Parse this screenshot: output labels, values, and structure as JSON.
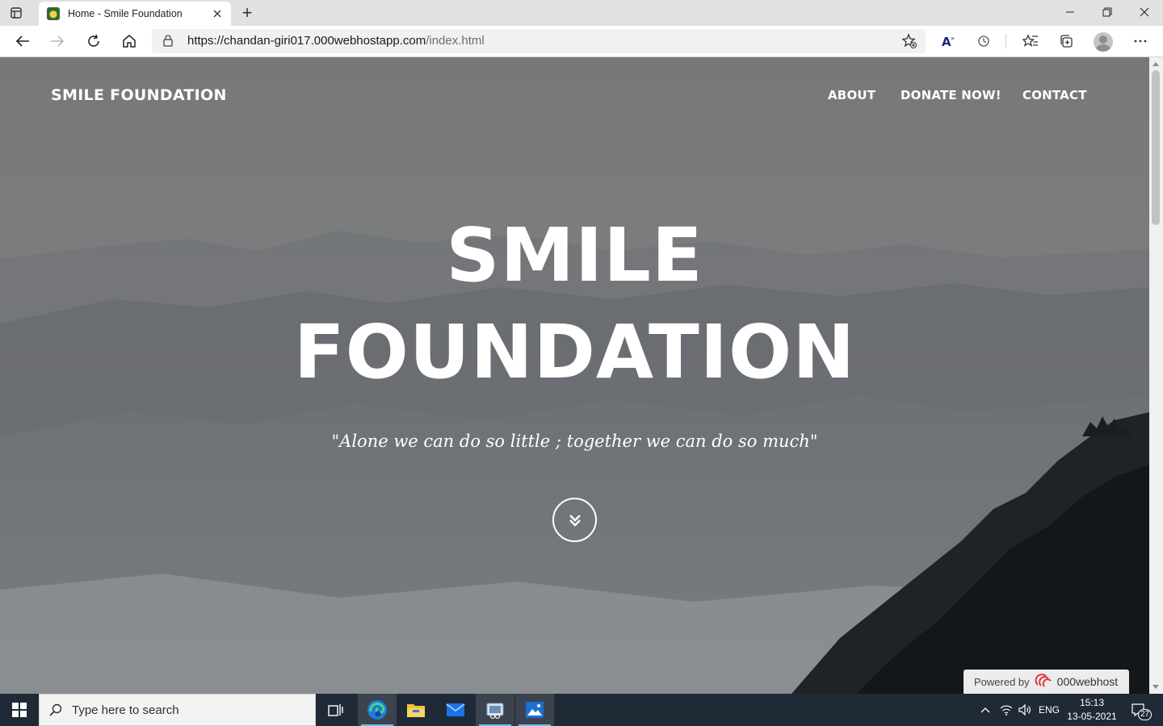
{
  "browser": {
    "tab_title": "Home - Smile Foundation",
    "new_tab_label": "+",
    "url_host": "https://chandan-giri017.000webhostapp.com",
    "url_path": "/index.html"
  },
  "site": {
    "brand": "SMILE FOUNDATION",
    "nav": [
      "ABOUT",
      "DONATE NOW!",
      "CONTACT"
    ],
    "hero_line1": "SMILE",
    "hero_line2": "FOUNDATION",
    "quote": "\"Alone we can do so little ; together we can do so much\"",
    "powered_label": "Powered by",
    "powered_brand": "000webhost"
  },
  "taskbar": {
    "search_placeholder": "Type here to search",
    "language": "ENG",
    "time": "15:13",
    "date": "13-05-2021",
    "notification_count": "27",
    "accent": "#76b9ed"
  },
  "icons": [
    "tab-actions-icon",
    "close-icon",
    "minimize-icon",
    "restore-icon",
    "back-icon",
    "forward-icon",
    "refresh-icon",
    "home-icon",
    "lock-icon",
    "add-favorite-icon",
    "read-aloud-icon",
    "tracking-icon",
    "favorites-icon",
    "collections-icon",
    "more-icon",
    "chevron-double-down-icon",
    "windows-icon",
    "search-icon",
    "task-view-icon",
    "edge-icon",
    "file-explorer-icon",
    "mail-icon",
    "snipping-icon",
    "photos-icon",
    "chevron-up-icon",
    "network-icon",
    "volume-icon",
    "notification-icon"
  ]
}
